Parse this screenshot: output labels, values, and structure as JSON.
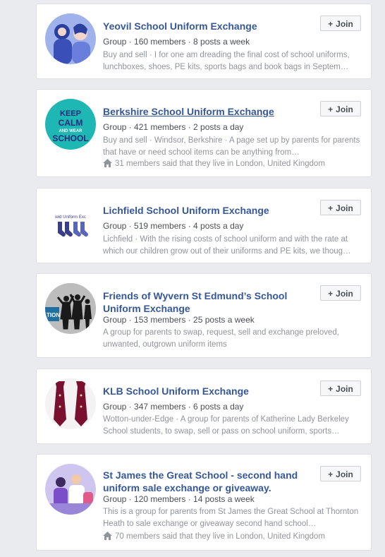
{
  "groups": [
    {
      "title": "Yeovil School Uniform Exchange",
      "meta": "Group · 160 members · 8 posts a week",
      "desc": "Buy and sell · I for one am dreading the final cost of school uniforms, lunchboxes, shoes, PE kits, sports bags and book bags in Septem…",
      "join": "Join"
    },
    {
      "title": "Berkshire School Uniform Exchange",
      "meta": "Group · 421 members · 2 posts a day",
      "desc": "Buy and sell · Windsor, Berkshire · A page set up by parents for parents that have or need school items can be anything from…",
      "location": "31 members said that they live in London, United Kingdom",
      "avatar_text": [
        "KEEP",
        "CALM",
        "AND WEAR",
        "SCHOOL"
      ],
      "join": "Join"
    },
    {
      "title": "Lichfield School Uniform Exchange",
      "meta": "Group · 519 members · 4 posts a day",
      "desc": "Lichfield · With the rising costs of school uniform and with the rate at which our children grow out of their uniforms and PE kits, we thoug…",
      "avatar_text": "ield Uniform Exc",
      "join": "Join"
    },
    {
      "title": "Friends of Wyvern St Edmund’s School Uniform Exchange",
      "meta": "Group · 153 members · 25 posts a week",
      "desc": "A group for parents to swap, request, sell and exchange preloved, unwanted, outgrown uniform items",
      "avatar_text": "TION",
      "join": "Join"
    },
    {
      "title": "KLB School Uniform Exchange",
      "meta": "Group · 347 members · 6 posts a day",
      "desc": "Wotton-under-Edge · A group for parents of Katherine Lady Berkeley School students, to swap, sell or pass on school uniform, sports…",
      "join": "Join"
    },
    {
      "title": "St James the Great School - second hand uniform sale exchange or giveaway.",
      "meta": "Group · 120 members · 14 posts a week",
      "desc": "This is a group for parents from St James the Great School at Thornton Heath to sale exchange or giveaway second hand school…",
      "location": "70 members said that they live in London, United Kingdom",
      "join": "Join"
    }
  ],
  "colors": {
    "link": "#365899",
    "background": "#e9ebee"
  }
}
